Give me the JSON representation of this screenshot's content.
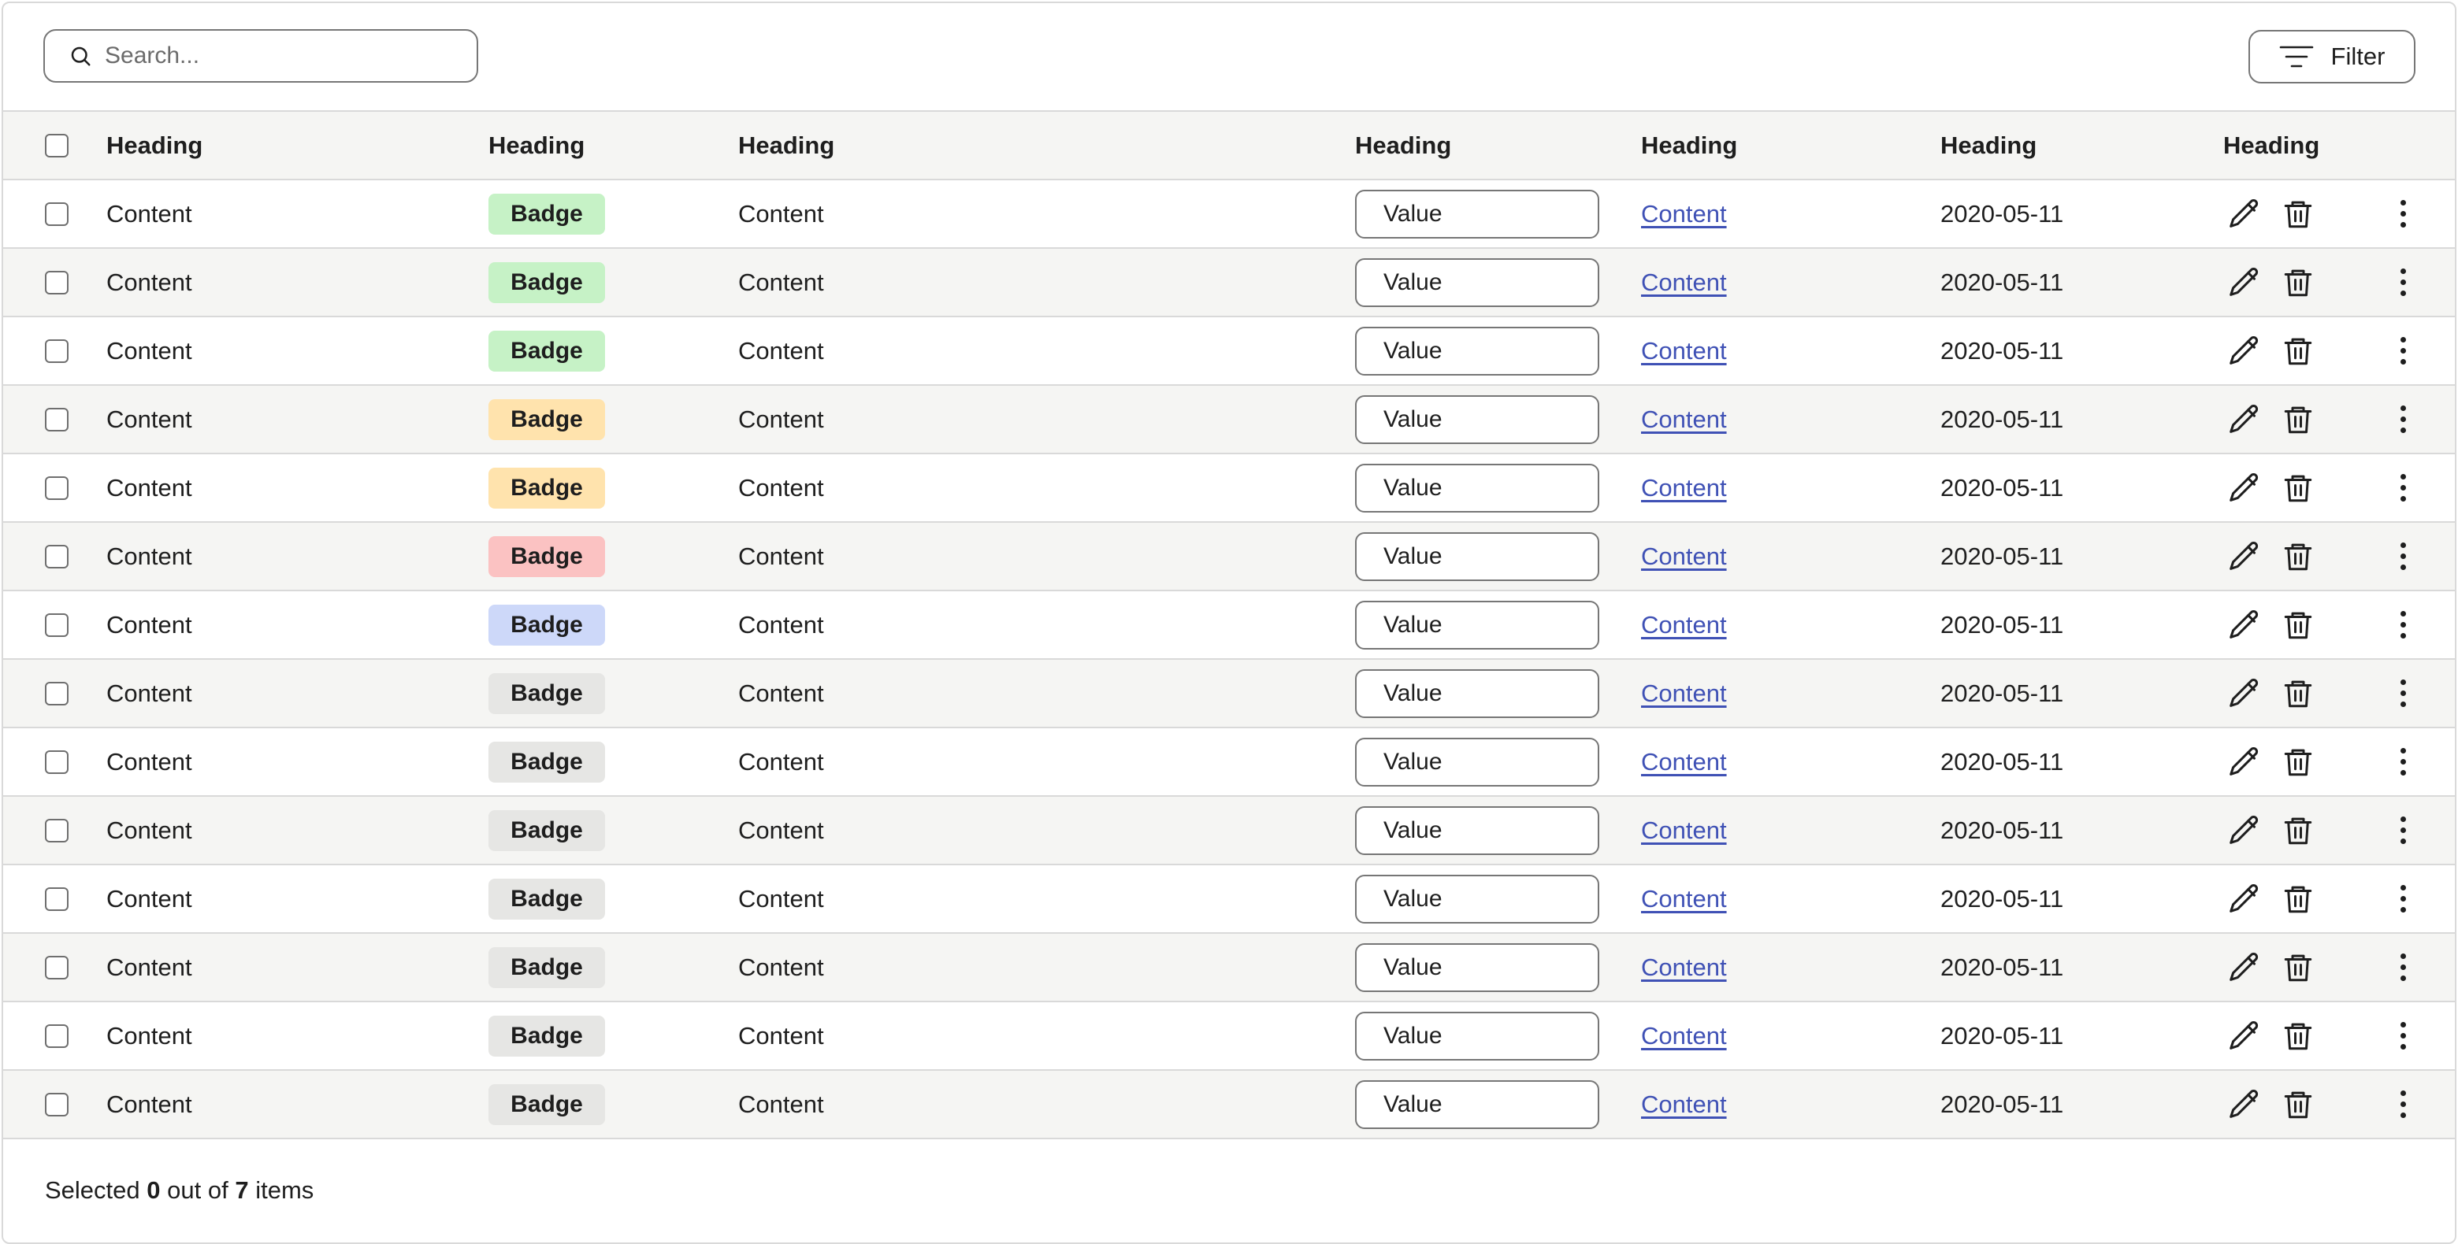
{
  "search": {
    "placeholder": "Search..."
  },
  "filter": {
    "label": "Filter",
    "icon": "filter-lines-icon"
  },
  "table": {
    "headers": [
      "Heading",
      "Heading",
      "Heading",
      "Heading",
      "Heading",
      "Heading",
      "Heading"
    ],
    "rows": [
      {
        "col1": "Content",
        "badge": "Badge",
        "badge_color": "#c6f2c6",
        "col3": "Content",
        "value": "Value",
        "link": "Content",
        "date": "2020-05-11"
      },
      {
        "col1": "Content",
        "badge": "Badge",
        "badge_color": "#c6f2c6",
        "col3": "Content",
        "value": "Value",
        "link": "Content",
        "date": "2020-05-11"
      },
      {
        "col1": "Content",
        "badge": "Badge",
        "badge_color": "#c6f2c6",
        "col3": "Content",
        "value": "Value",
        "link": "Content",
        "date": "2020-05-11"
      },
      {
        "col1": "Content",
        "badge": "Badge",
        "badge_color": "#ffe3ad",
        "col3": "Content",
        "value": "Value",
        "link": "Content",
        "date": "2020-05-11"
      },
      {
        "col1": "Content",
        "badge": "Badge",
        "badge_color": "#ffe3ad",
        "col3": "Content",
        "value": "Value",
        "link": "Content",
        "date": "2020-05-11"
      },
      {
        "col1": "Content",
        "badge": "Badge",
        "badge_color": "#fbc2c2",
        "col3": "Content",
        "value": "Value",
        "link": "Content",
        "date": "2020-05-11"
      },
      {
        "col1": "Content",
        "badge": "Badge",
        "badge_color": "#cdd8f9",
        "col3": "Content",
        "value": "Value",
        "link": "Content",
        "date": "2020-05-11"
      },
      {
        "col1": "Content",
        "badge": "Badge",
        "badge_color": "#e6e6e4",
        "col3": "Content",
        "value": "Value",
        "link": "Content",
        "date": "2020-05-11"
      },
      {
        "col1": "Content",
        "badge": "Badge",
        "badge_color": "#e6e6e4",
        "col3": "Content",
        "value": "Value",
        "link": "Content",
        "date": "2020-05-11"
      },
      {
        "col1": "Content",
        "badge": "Badge",
        "badge_color": "#e6e6e4",
        "col3": "Content",
        "value": "Value",
        "link": "Content",
        "date": "2020-05-11"
      },
      {
        "col1": "Content",
        "badge": "Badge",
        "badge_color": "#e6e6e4",
        "col3": "Content",
        "value": "Value",
        "link": "Content",
        "date": "2020-05-11"
      },
      {
        "col1": "Content",
        "badge": "Badge",
        "badge_color": "#e6e6e4",
        "col3": "Content",
        "value": "Value",
        "link": "Content",
        "date": "2020-05-11"
      },
      {
        "col1": "Content",
        "badge": "Badge",
        "badge_color": "#e6e6e4",
        "col3": "Content",
        "value": "Value",
        "link": "Content",
        "date": "2020-05-11"
      },
      {
        "col1": "Content",
        "badge": "Badge",
        "badge_color": "#e6e6e4",
        "col3": "Content",
        "value": "Value",
        "link": "Content",
        "date": "2020-05-11"
      }
    ],
    "row_actions": [
      "pencil-edit-icon",
      "trash-delete-icon",
      "more-vertical-icon"
    ]
  },
  "footer": {
    "prefix": "Selected",
    "selected": "0",
    "middle": "out of",
    "total": "7",
    "suffix": "items"
  },
  "colors": {
    "link": "#3f51b5",
    "header_bg": "#f5f5f3",
    "border": "#d9d9d9"
  }
}
